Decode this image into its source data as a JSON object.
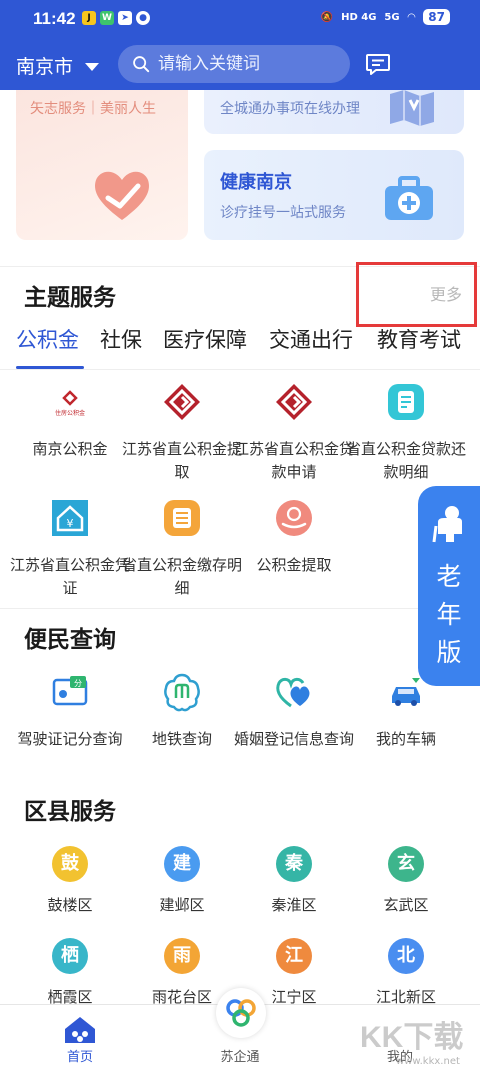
{
  "status_bar": {
    "time": "11:42",
    "signal1": "HD 4G",
    "signal2": "5G",
    "battery": "87"
  },
  "header": {
    "city": "南京市",
    "search_placeholder": "请输入关键词"
  },
  "banner_cards": {
    "left_text": "矢志服务｜美丽人生",
    "right_top_text": "全城通办事项在线办理",
    "right_bottom_title": "健康南京",
    "right_bottom_sub": "诊疗挂号一站式服务"
  },
  "theme_services": {
    "title": "主题服务",
    "more": "更多",
    "tabs": [
      "公积金",
      "社保",
      "医疗保障",
      "交通出行",
      "教育考试"
    ],
    "active_tab": "公积金",
    "items": [
      {
        "label": "南京公积金",
        "icon": "nanjing-gjj-logo-icon"
      },
      {
        "label": "江苏省直公积金提取",
        "icon": "diamond-red-icon"
      },
      {
        "label": "江苏省直公积金贷款申请",
        "icon": "diamond-red-icon"
      },
      {
        "label": "省直公积金贷款还款明细",
        "icon": "document-teal-icon"
      },
      {
        "label": "江苏省直公积金凭证",
        "icon": "house-yuan-icon"
      },
      {
        "label": "省直公积金缴存明细",
        "icon": "list-orange-icon"
      },
      {
        "label": "公积金提取",
        "icon": "hand-coin-icon"
      }
    ]
  },
  "convenience": {
    "title": "便民查询",
    "items": [
      {
        "label": "驾驶证记分查询",
        "icon": "license-points-icon"
      },
      {
        "label": "地铁查询",
        "icon": "metro-icon"
      },
      {
        "label": "婚姻登记信息查询",
        "icon": "heart-marriage-icon"
      },
      {
        "label": "我的车辆",
        "icon": "car-icon"
      }
    ]
  },
  "district": {
    "title": "区县服务",
    "items": [
      {
        "char": "鼓",
        "label": "鼓楼区",
        "color": "#f2c230"
      },
      {
        "char": "建",
        "label": "建邺区",
        "color": "#4a9bf0"
      },
      {
        "char": "秦",
        "label": "秦淮区",
        "color": "#35b5a6"
      },
      {
        "char": "玄",
        "label": "玄武区",
        "color": "#3db58c"
      },
      {
        "char": "栖",
        "label": "栖霞区",
        "color": "#38b6c9"
      },
      {
        "char": "雨",
        "label": "雨花台区",
        "color": "#f3a535"
      },
      {
        "char": "江",
        "label": "江宁区",
        "color": "#ef8a3e"
      },
      {
        "char": "北",
        "label": "江北新区",
        "color": "#4a8ef0"
      }
    ]
  },
  "elder_mode": {
    "label": "老年版"
  },
  "bottom_nav": {
    "home": "首页",
    "center": "苏企通",
    "mine": "我的"
  },
  "watermark": {
    "text": "KK下载",
    "url": "www.kkx.net"
  },
  "colors": {
    "primary": "#2f57d4",
    "highlight_box": "#e53a3a",
    "elder": "#3b82ee"
  }
}
